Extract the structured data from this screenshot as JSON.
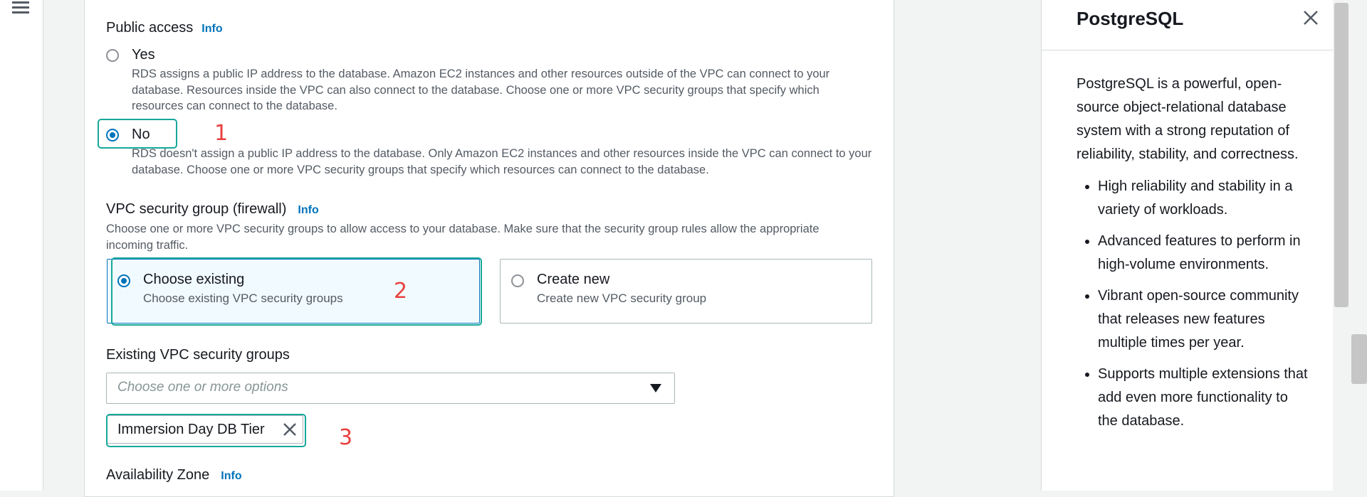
{
  "public_access": {
    "label": "Public access",
    "info": "Info",
    "yes": {
      "label": "Yes",
      "description": "RDS assigns a public IP address to the database. Amazon EC2 instances and other resources outside of the VPC can connect to your database. Resources inside the VPC can also connect to the database. Choose one or more VPC security groups that specify which resources can connect to the database."
    },
    "no": {
      "label": "No",
      "description": "RDS doesn't assign a public IP address to the database. Only Amazon EC2 instances and other resources inside the VPC can connect to your database. Choose one or more VPC security groups that specify which resources can connect to the database."
    },
    "selected": "No"
  },
  "vpc_security_group": {
    "label": "VPC security group (firewall)",
    "info": "Info",
    "description": "Choose one or more VPC security groups to allow access to your database. Make sure that the security group rules allow the appropriate incoming traffic.",
    "choose_existing": {
      "title": "Choose existing",
      "subtitle": "Choose existing VPC security groups"
    },
    "create_new": {
      "title": "Create new",
      "subtitle": "Create new VPC security group"
    },
    "selected": "Choose existing"
  },
  "existing_groups": {
    "label": "Existing VPC security groups",
    "placeholder": "Choose one or more options",
    "tokens": [
      "Immersion Day DB Tier"
    ]
  },
  "availability_zone": {
    "label": "Availability Zone",
    "info": "Info"
  },
  "annotations": [
    "1",
    "2",
    "3"
  ],
  "side_panel": {
    "title": "PostgreSQL",
    "intro": "PostgreSQL is a powerful, open-source object-relational database system with a strong reputation of reliability, stability, and correctness.",
    "bullets": [
      "High reliability and stability in a variety of workloads.",
      "Advanced features to perform in high-volume environments.",
      "Vibrant open-source community that releases new features multiple times per year.",
      "Supports multiple extensions that add even more functionality to the database."
    ]
  },
  "colors": {
    "accent": "#0073bb",
    "annotation_box": "#16a89a",
    "annotation_number": "#e8413f"
  },
  "icons": {
    "menu": "hamburger-icon",
    "close": "close-icon",
    "remove": "remove-token-icon",
    "dropdown": "caret-down-icon"
  }
}
